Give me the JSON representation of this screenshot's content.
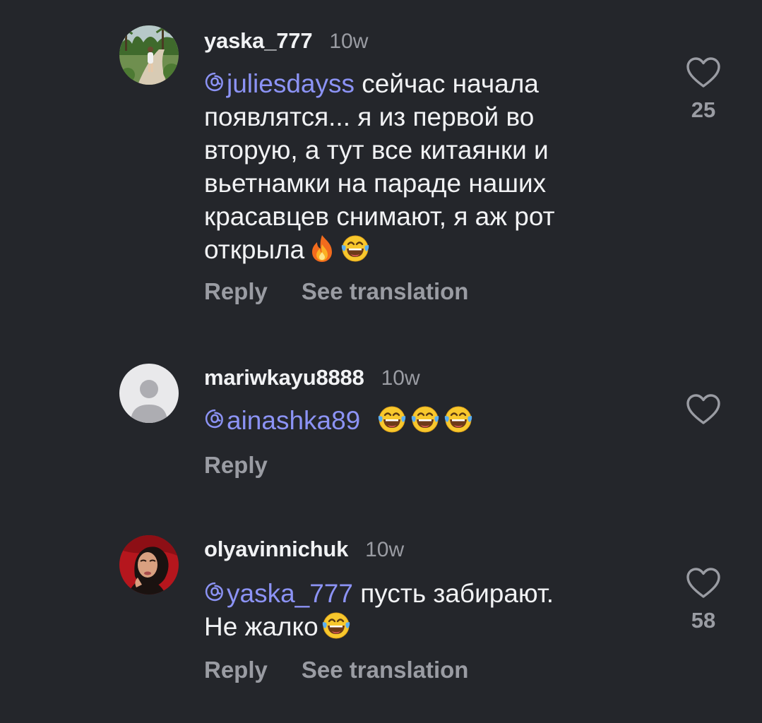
{
  "comments": [
    {
      "username": "yaska_777",
      "time": "10w",
      "mention": "juliesdayss",
      "lines": [
        "сейчас начала",
        "появлятся... я из первой во",
        "вторую, а тут все китаянки и",
        "вьетнамки на параде наших",
        "красавцев снимают, я аж рот",
        "открыла"
      ],
      "emojis": [
        "fire",
        "face-with-tears-of-joy"
      ],
      "reply_label": "Reply",
      "translate_label": "See translation",
      "like_count": "25"
    },
    {
      "username": "mariwkayu8888",
      "time": "10w",
      "mention": "ainashka89",
      "emojis": [
        "face-with-tears-of-joy",
        "face-with-tears-of-joy",
        "face-with-tears-of-joy"
      ],
      "reply_label": "Reply"
    },
    {
      "username": "olyavinnichuk",
      "time": "10w",
      "mention": "yaska_777",
      "lines": [
        "пусть забирают.",
        "Не жалко"
      ],
      "emojis": [
        "face-with-tears-of-joy"
      ],
      "reply_label": "Reply",
      "translate_label": "See translation",
      "like_count": "58"
    }
  ],
  "colors": {
    "background": "#24262b",
    "text": "#f1f2f4",
    "muted": "#9a9ca3",
    "mention": "#8c93f5"
  }
}
